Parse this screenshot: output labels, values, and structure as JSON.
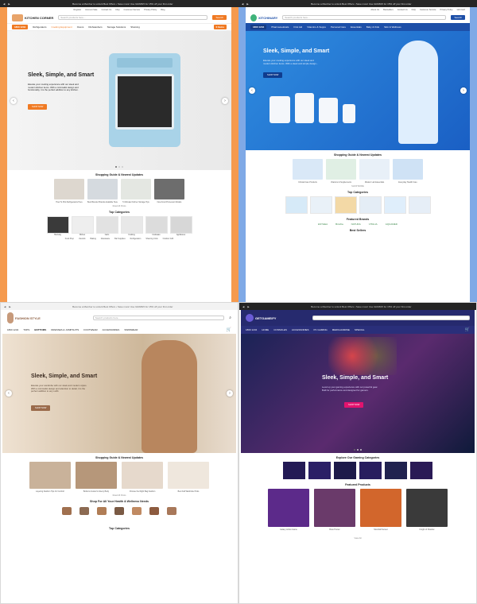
{
  "q1": {
    "promo": "Become a Member to unlock Best Offers • Save more! Use GRAB15 for 15% off your first order",
    "logo": "KITCHEN CORNER",
    "search_placeholder": "Search products here...",
    "search_btn": "Search",
    "toplinks": [
      "Register",
      "Account Sale",
      "Contact Us",
      "FAQ",
      "Customer Service",
      "Privacy Policy",
      "Blog",
      "Gift Card"
    ],
    "phone": "1800 1234",
    "menu": [
      "Refrigerators",
      "Cooking Equipment",
      "Ovens",
      "Dishwashers",
      "Storage Solutions",
      "Shelving"
    ],
    "cart": "0 Items",
    "hero_title": "Sleek, Simple, and Smart",
    "hero_text": "Elevate your cooking experience with our sleek and modern kitchen items. With a minimalist design and functionality, it is the perfect addition to any kitchen.",
    "hero_btn": "SHOP NOW",
    "section1": "Shopping Guide & Newest Updates",
    "cards": [
      "How To Pick Refrigerators Here",
      "Best Blender Brands Available Here",
      "5 Ultimate Kitchen Storage Tips",
      "New Food Processor Models"
    ],
    "more": "Read All Posts",
    "section2": "Top Categories",
    "tiles": [
      "Shelving",
      "Dishes",
      "Carts",
      "Cooking",
      "Cookware",
      "Appliances"
    ],
    "row2": [
      "Food Prep",
      "Utensils",
      "Baking",
      "Glassware",
      "Bar Supplies",
      "Refrigeration",
      "Shelving Units",
      "Outdoor Grill"
    ]
  },
  "q2": {
    "promo": "Become a Member to unlock Best Offers • Save more! Use GRAB15 for 15% off your first order",
    "logo": "XITCHINARY",
    "search_placeholder": "Search products here...",
    "search_btn": "Search",
    "toplinks": [
      "About Us",
      "Bestsellers",
      "Contact Us",
      "FAQ",
      "Customer Service",
      "Privacy Policy",
      "Gift Card"
    ],
    "phone": "1800 1234",
    "menu": [
      "Pharmaceuticals",
      "First Aid",
      "Vitamins & Supps",
      "Personal Care",
      "Essentials",
      "Baby & Kids",
      "Skin & Wellness"
    ],
    "hero_title": "Sleek, Simple, and Smart",
    "hero_text": "Elevate your cooking experience with our sleek and modern kitchen items. With a sleek and simple design...",
    "hero_btn": "SHOP NOW",
    "section1": "Shopping Guide & Newest Updates",
    "cards": [
      "Clinical Care Products",
      "Vitamins & Supplements",
      "Modern Lab Essentials",
      "Everyday Health Care"
    ],
    "more": "SHOP MORE",
    "section2": "Top Categories",
    "section3": "Featured Brands",
    "brands": [
      "ESTHEA",
      "BioVita",
      "NATURA",
      "VITALIA",
      "AQUAMED"
    ],
    "section4": "Best Sellers"
  },
  "q3": {
    "promo": "Become a Member to unlock Best Offers • Save more! Use GRAB15 for 15% off your first order",
    "logo": "FASHION STYLE",
    "phone": "1800 1234",
    "menu": [
      "TOPS",
      "BOTTOMS",
      "DRESSES & JUMPSUITS",
      "FOOTWEAR",
      "ACCESSORIES",
      "SWIMWEAR"
    ],
    "search_placeholder": "Search products here...",
    "hero_title": "Sleek, Simple, and Smart",
    "hero_text": "Elevate your wardrobe with our sleek and modern styles. With a minimalist design and attention to detail, it is the perfect addition to any outfit.",
    "hero_btn": "SHOP NOW",
    "section1": "Shopping Guide & Newest Updates",
    "cards": [
      "Layering Fashion Tips for Comfort",
      "Bottoms Guide for Every Body",
      "Choose the Right Bag Fashion",
      "Best Fall Wardrobe Picks"
    ],
    "more": "Read All Posts",
    "section2": "Shop For All Your Health & Wellness Needs",
    "section3": "Top Categories"
  },
  "q4": {
    "promo": "Become a Member to unlock Best Offers • Save more! Use GRAB15 for 15% off your first order",
    "logo": "GETGAMEIFY",
    "phone": "1800 1234",
    "menu": [
      "HOME",
      "CONSOLES",
      "ACCESSORIES",
      "PC GAMING",
      "MERCHANDISE",
      "SPECIAL"
    ],
    "hero_title": "Sleek, Simple, and Smart",
    "hero_text": "Level up your gaming experience with our powerful gear. Built for performance and designed for gamers.",
    "hero_btn": "SHOP NOW",
    "section1": "Explore Our Gaming Categories",
    "section2": "Featured Products",
    "products": [
      "Galaxy Action Game",
      "Boss Hunter",
      "Moonfall Sunset",
      "Knight of Shadow"
    ],
    "more_btn": "View All",
    "colors": {
      "brand": "#2a2f7a",
      "accent": "#e2136e",
      "orange": "#f07a23",
      "blue": "#1d4fa8"
    }
  }
}
